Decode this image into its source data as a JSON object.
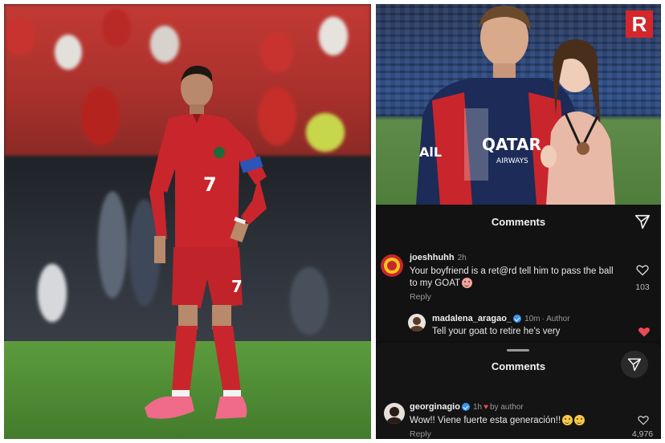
{
  "left_photo": {
    "jersey_number": "7"
  },
  "right_panel": {
    "logo_letter": "R",
    "jersey_sponsor": "QATAR",
    "jersey_sponsor_sub": "AIRWAYS",
    "jersey_side_text": "AlL",
    "comments_header": "Comments",
    "comments": [
      {
        "username": "joeshhuhh",
        "time": "2h",
        "text": "Your boyfriend is a ret@rd tell him to pass the ball to my GOAT",
        "reply_label": "Reply",
        "likes": "103"
      },
      {
        "username": "madalena_aragao_",
        "time": "10m",
        "author_tag": "· Author",
        "text": "Tell your goat to retire he's very"
      }
    ],
    "sheet": {
      "header": "Comments",
      "comment": {
        "username": "georginagio",
        "time": "1h",
        "by_author": "by author",
        "text": "Wow!! Viene fuerte esta generación!!",
        "reply_label": "Reply",
        "likes": "4,976"
      }
    }
  },
  "colors": {
    "portugal_red": "#c8262c",
    "psg_navy": "#1c2b57",
    "instagram_like": "#ed4956",
    "verified_blue": "#3897f0",
    "relevo_red": "#d4262b"
  },
  "icons": [
    "send-icon",
    "heart-outline-icon",
    "heart-filled-icon",
    "verified-badge-icon",
    "emoji-icon"
  ]
}
